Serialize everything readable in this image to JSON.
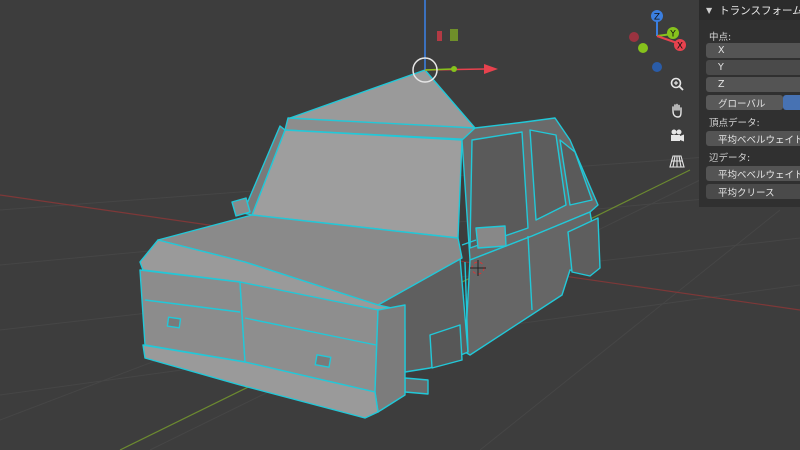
{
  "panel": {
    "header_arrow": "▼",
    "title": "トランスフォーム",
    "median_label": "中点:",
    "axis_x": "X",
    "axis_y": "Y",
    "axis_z": "Z",
    "orientation": "グローバル",
    "vertex_data_label": "頂点データ:",
    "vertex_bevel_weight": "平均ベベルウェイト",
    "edge_data_label": "辺データ:",
    "edge_bevel_weight": "平均ベベルウェイト",
    "edge_crease": "平均クリース"
  },
  "gizmo": {
    "z_label": "Z",
    "y_label": "Y",
    "x_label": "X"
  },
  "nav_icons": [
    "zoom-icon",
    "hand-pan-icon",
    "camera-icon",
    "perspective-grid-icon"
  ],
  "colors": {
    "background": "#3d3d3d",
    "grid_line": "#454545",
    "axis_x_line": "#8a3a3a",
    "axis_y_line": "#6e8a2e",
    "mesh_edge": "#22c8d8",
    "mesh_face": "#808080",
    "gizmo_x": "#e8424e",
    "gizmo_y": "#86c21c",
    "gizmo_z": "#3b7fe0",
    "panel_bg": "#303030",
    "accent_blue": "#4772b3"
  }
}
